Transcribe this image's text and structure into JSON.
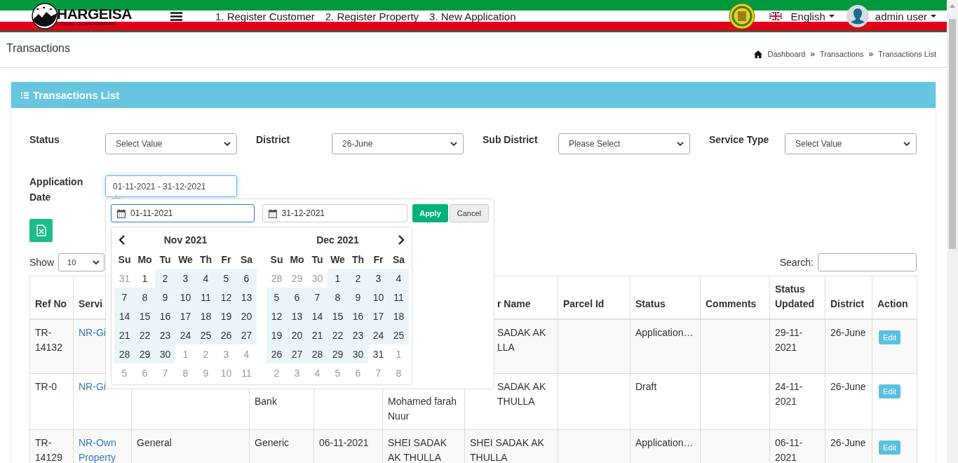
{
  "logo": {
    "title": "HARGEISA",
    "subtitle": "LOCAL GOVERNMENT"
  },
  "nav_links": [
    "1. Register Customer",
    "2. Register Property",
    "3. New Application"
  ],
  "language": {
    "label": "English"
  },
  "user": {
    "name": "admin user"
  },
  "page_title": "Transactions",
  "breadcrumb": [
    {
      "kind": "link",
      "text": "Dashboard"
    },
    {
      "kind": "sep",
      "text": "»"
    },
    {
      "kind": "link",
      "text": "Transactions"
    },
    {
      "kind": "sep",
      "text": "»"
    },
    {
      "kind": "link",
      "text": "Transactions List"
    }
  ],
  "card": {
    "title": "Transactions List"
  },
  "filters": [
    {
      "label": "Status",
      "value": "Select Value"
    },
    {
      "label": "District",
      "value": "26-June"
    },
    {
      "label": "Sub District",
      "value": "Please Select"
    },
    {
      "label": "Service Type",
      "value": "Select Value"
    }
  ],
  "date_filter": {
    "label": "Application Date",
    "value": "01-11-2021 - 31-12-2021",
    "focused": true
  },
  "date_picker": {
    "start": "01-11-2021",
    "end": "31-12-2021",
    "apply": "Apply",
    "cancel": "Cancel",
    "months": [
      {
        "title": "Nov 2021",
        "weekdays": [
          "Su",
          "Mo",
          "Tu",
          "We",
          "Th",
          "Fr",
          "Sa"
        ],
        "weeks": [
          [
            {
              "d": "31",
              "kind": "off"
            },
            {
              "d": "1",
              "kind": "day"
            },
            {
              "d": "2",
              "kind": "range"
            },
            {
              "d": "3",
              "kind": "range"
            },
            {
              "d": "4",
              "kind": "range"
            },
            {
              "d": "5",
              "kind": "range"
            },
            {
              "d": "6",
              "kind": "range"
            }
          ],
          [
            {
              "d": "7",
              "kind": "range"
            },
            {
              "d": "8",
              "kind": "range"
            },
            {
              "d": "9",
              "kind": "range"
            },
            {
              "d": "10",
              "kind": "range"
            },
            {
              "d": "11",
              "kind": "range"
            },
            {
              "d": "12",
              "kind": "range"
            },
            {
              "d": "13",
              "kind": "range"
            }
          ],
          [
            {
              "d": "14",
              "kind": "range"
            },
            {
              "d": "15",
              "kind": "range"
            },
            {
              "d": "16",
              "kind": "range"
            },
            {
              "d": "17",
              "kind": "range"
            },
            {
              "d": "18",
              "kind": "range"
            },
            {
              "d": "19",
              "kind": "range"
            },
            {
              "d": "20",
              "kind": "range"
            }
          ],
          [
            {
              "d": "21",
              "kind": "range"
            },
            {
              "d": "22",
              "kind": "range"
            },
            {
              "d": "23",
              "kind": "range"
            },
            {
              "d": "24",
              "kind": "range"
            },
            {
              "d": "25",
              "kind": "range"
            },
            {
              "d": "26",
              "kind": "range"
            },
            {
              "d": "27",
              "kind": "range"
            }
          ],
          [
            {
              "d": "28",
              "kind": "range"
            },
            {
              "d": "29",
              "kind": "range"
            },
            {
              "d": "30",
              "kind": "range"
            },
            {
              "d": "1",
              "kind": "off"
            },
            {
              "d": "2",
              "kind": "off"
            },
            {
              "d": "3",
              "kind": "off"
            },
            {
              "d": "4",
              "kind": "off"
            }
          ],
          [
            {
              "d": "5",
              "kind": "off"
            },
            {
              "d": "6",
              "kind": "off"
            },
            {
              "d": "7",
              "kind": "off"
            },
            {
              "d": "8",
              "kind": "off"
            },
            {
              "d": "9",
              "kind": "off"
            },
            {
              "d": "10",
              "kind": "off"
            },
            {
              "d": "11",
              "kind": "off"
            }
          ]
        ]
      },
      {
        "title": "Dec 2021",
        "weekdays": [
          "Su",
          "Mo",
          "Tu",
          "We",
          "Th",
          "Fr",
          "Sa"
        ],
        "weeks": [
          [
            {
              "d": "28",
              "kind": "off"
            },
            {
              "d": "29",
              "kind": "off"
            },
            {
              "d": "30",
              "kind": "off"
            },
            {
              "d": "1",
              "kind": "range"
            },
            {
              "d": "2",
              "kind": "range"
            },
            {
              "d": "3",
              "kind": "range"
            },
            {
              "d": "4",
              "kind": "range"
            }
          ],
          [
            {
              "d": "5",
              "kind": "range"
            },
            {
              "d": "6",
              "kind": "range"
            },
            {
              "d": "7",
              "kind": "range"
            },
            {
              "d": "8",
              "kind": "range"
            },
            {
              "d": "9",
              "kind": "range"
            },
            {
              "d": "10",
              "kind": "range"
            },
            {
              "d": "11",
              "kind": "range"
            }
          ],
          [
            {
              "d": "12",
              "kind": "range"
            },
            {
              "d": "13",
              "kind": "range"
            },
            {
              "d": "14",
              "kind": "range"
            },
            {
              "d": "15",
              "kind": "range"
            },
            {
              "d": "16",
              "kind": "range"
            },
            {
              "d": "17",
              "kind": "range"
            },
            {
              "d": "18",
              "kind": "range"
            }
          ],
          [
            {
              "d": "19",
              "kind": "range"
            },
            {
              "d": "20",
              "kind": "range"
            },
            {
              "d": "21",
              "kind": "range"
            },
            {
              "d": "22",
              "kind": "range"
            },
            {
              "d": "23",
              "kind": "range"
            },
            {
              "d": "24",
              "kind": "range"
            },
            {
              "d": "25",
              "kind": "range"
            }
          ],
          [
            {
              "d": "26",
              "kind": "range"
            },
            {
              "d": "27",
              "kind": "range"
            },
            {
              "d": "28",
              "kind": "range"
            },
            {
              "d": "29",
              "kind": "range"
            },
            {
              "d": "30",
              "kind": "range"
            },
            {
              "d": "31",
              "kind": "day"
            },
            {
              "d": "1",
              "kind": "off"
            }
          ],
          [
            {
              "d": "2",
              "kind": "off"
            },
            {
              "d": "3",
              "kind": "off"
            },
            {
              "d": "4",
              "kind": "off"
            },
            {
              "d": "5",
              "kind": "off"
            },
            {
              "d": "6",
              "kind": "off"
            },
            {
              "d": "7",
              "kind": "off"
            },
            {
              "d": "8",
              "kind": "off"
            }
          ]
        ]
      }
    ]
  },
  "show": {
    "label": "Show",
    "value": "10"
  },
  "search": {
    "label": "Search:"
  },
  "table": {
    "columns": [
      {
        "label": "Ref No"
      },
      {
        "label": "Servi"
      },
      {},
      {},
      {},
      {},
      {
        "label": "r Name",
        "covered": true
      },
      {
        "label": "Parcel Id"
      },
      {
        "label": "Status"
      },
      {
        "label": "Comments"
      },
      {
        "label": "Status Updated"
      },
      {
        "label": "District"
      },
      {
        "label": "Action"
      }
    ],
    "rows": [
      {
        "cells": [
          {
            "text": "TR-14132"
          },
          {
            "text": "NR-Gi",
            "link": true
          },
          {},
          {},
          {},
          {},
          {
            "text": "SADAK AK LLA",
            "covered": true
          },
          {},
          {
            "text": "Application…"
          },
          {},
          {
            "text": "29-11-2021"
          },
          {
            "text": "26-June"
          },
          {
            "button": "Edit"
          }
        ]
      },
      {
        "cells": [
          {
            "text": "TR-0"
          },
          {
            "text": "NR-Gi",
            "link": true
          },
          {},
          {
            "text": "Bank",
            "continued": true
          },
          {},
          {
            "text": "Mohamed farah Nuur",
            "continued": true
          },
          {
            "text": "SADAK AK THULLA",
            "covered": true
          },
          {},
          {
            "text": "Draft"
          },
          {},
          {
            "text": "24-11-2021"
          },
          {
            "text": "26-June"
          },
          {
            "button": "Edit"
          }
        ]
      },
      {
        "cells": [
          {
            "text": "TR-14129"
          },
          {
            "text": "NR-Own Property",
            "link": true
          },
          {
            "text": "General"
          },
          {
            "text": "Generic"
          },
          {
            "text": "06-11-2021"
          },
          {
            "text": "SHEI SADAK AK THULLA"
          },
          {
            "text": "SHEI SADAK AK THULLA"
          },
          {},
          {
            "text": "Application…"
          },
          {},
          {
            "text": "06-11-2021"
          },
          {
            "text": "26-June"
          },
          {
            "button": "Edit"
          }
        ]
      }
    ]
  }
}
